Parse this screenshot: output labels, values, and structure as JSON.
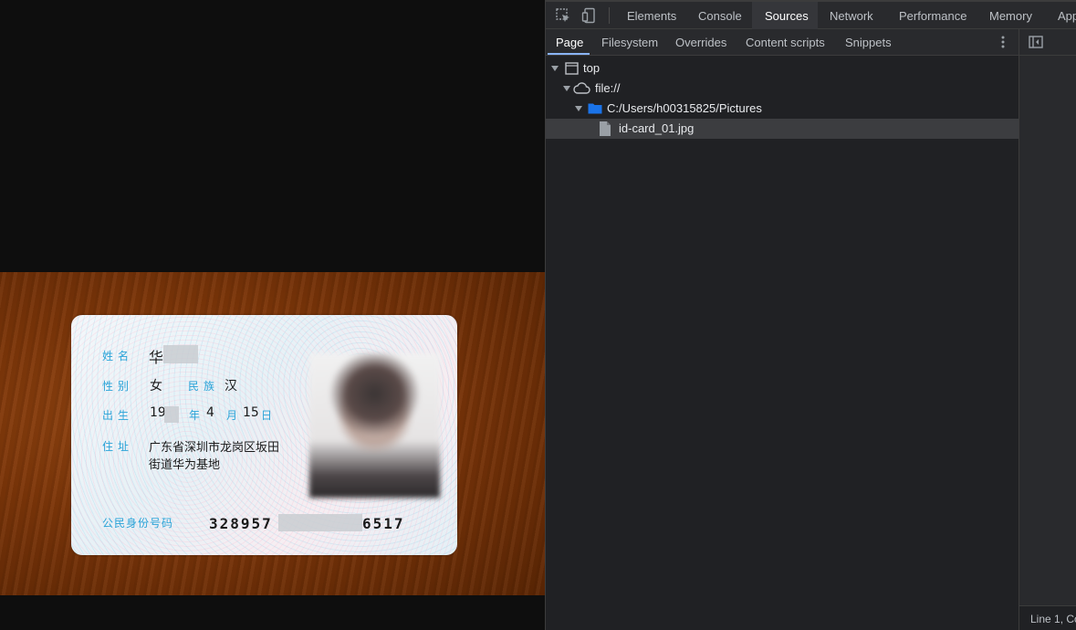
{
  "devtools": {
    "main_tabs": [
      {
        "label": "Elements"
      },
      {
        "label": "Console"
      },
      {
        "label": "Sources"
      },
      {
        "label": "Network"
      },
      {
        "label": "Performance"
      },
      {
        "label": "Memory"
      },
      {
        "label": "App"
      }
    ],
    "active_main_tab": "Sources",
    "sub_tabs": [
      {
        "label": "Page"
      },
      {
        "label": "Filesystem"
      },
      {
        "label": "Overrides"
      },
      {
        "label": "Content scripts"
      },
      {
        "label": "Snippets"
      }
    ],
    "active_sub_tab": "Page",
    "tree": {
      "top": "top",
      "origin": "file://",
      "folder": "C:/Users/h00315825/Pictures",
      "file": "id-card_01.jpg"
    },
    "status_bar": "Line 1, Co"
  },
  "id_card": {
    "name_label": "姓名",
    "name_value": "华",
    "gender_label": "性别",
    "gender_value": "女",
    "ethnicity_label": "民族",
    "ethnicity_value": "汉",
    "birth_label": "出生",
    "birth_year": "19",
    "year_label": "年",
    "birth_month": "4",
    "month_label": "月",
    "birth_day": "15",
    "day_label": "日",
    "address_label": "住址",
    "address_line1": "广东省深圳市龙岗区坂田",
    "address_line2": "街道华为基地",
    "id_label": "公民身份号码",
    "id_prefix": "328957",
    "id_suffix": "6517"
  },
  "colors": {
    "devtools_bg": "#202124",
    "accent": "#8ab4f8",
    "card_label": "#2aa3d8",
    "folder": "#1a73e8"
  }
}
